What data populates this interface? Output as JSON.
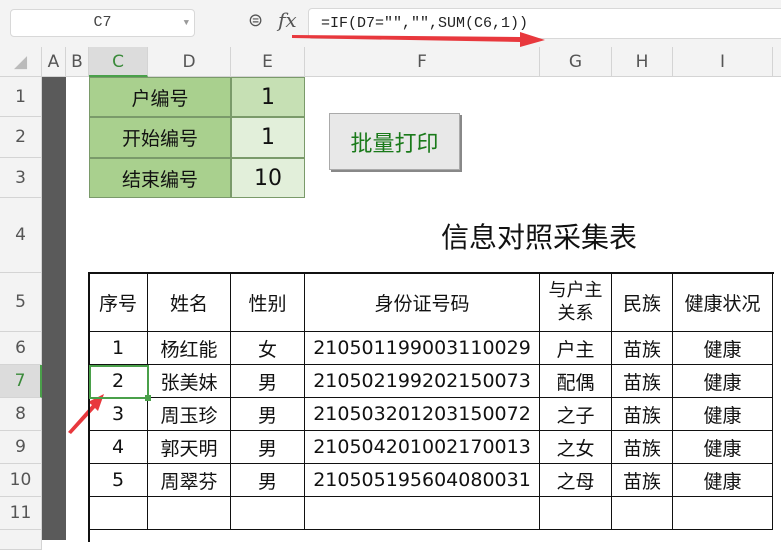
{
  "name_box": "C7",
  "formula": "=IF(D7=\"\",\"\",SUM(C6,1))",
  "columns": [
    "A",
    "B",
    "C",
    "D",
    "E",
    "F",
    "G",
    "H",
    "I"
  ],
  "rows": [
    "1",
    "2",
    "3",
    "4",
    "5",
    "6",
    "7",
    "8",
    "9",
    "10",
    "11"
  ],
  "params": [
    {
      "label": "户编号",
      "value": "1"
    },
    {
      "label": "开始编号",
      "value": "1"
    },
    {
      "label": "结束编号",
      "value": "10"
    }
  ],
  "print_button": "批量打印",
  "table_title": "信息对照采集表",
  "headers": [
    "序号",
    "姓名",
    "性别",
    "身份证号码",
    "与户主\n关系",
    "民族",
    "健康状况"
  ],
  "records": [
    [
      "1",
      "杨红能",
      "女",
      "210501199003110029",
      "户主",
      "苗族",
      "健康"
    ],
    [
      "2",
      "张美妹",
      "男",
      "210502199202150073",
      "配偶",
      "苗族",
      "健康"
    ],
    [
      "3",
      "周玉珍",
      "男",
      "210503201203150072",
      "之子",
      "苗族",
      "健康"
    ],
    [
      "4",
      "郭天明",
      "男",
      "210504201002170013",
      "之女",
      "苗族",
      "健康"
    ],
    [
      "5",
      "周翠芬",
      "男",
      "210505195604080031",
      "之母",
      "苗族",
      "健康"
    ]
  ],
  "colors": {
    "accent": "#4aa04a",
    "param_label_bg": "#a9d08e",
    "param_value_bg": "#c6e0b4",
    "arrow": "#e8383d"
  }
}
